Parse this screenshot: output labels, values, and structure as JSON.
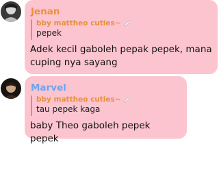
{
  "messages": [
    {
      "sender": "Jenan",
      "sender_color": "#e8903f",
      "reply": {
        "author": "bby mattheo cuties~",
        "text": "pepek"
      },
      "text": "Adek kecil gaboleh pepak pepek, mana cuping nya sayang"
    },
    {
      "sender": "Marvel",
      "sender_color": "#6aa6f0",
      "reply": {
        "author": "bby mattheo cuties~",
        "text": "tau pepek kaga"
      },
      "text": "baby Theo gaboleh pepek pepek"
    }
  ],
  "colors": {
    "bubble": "#fcc4cf",
    "reply_accent": "#e8903f"
  },
  "icons": {
    "reply_author_badge": "pencil-icon"
  }
}
